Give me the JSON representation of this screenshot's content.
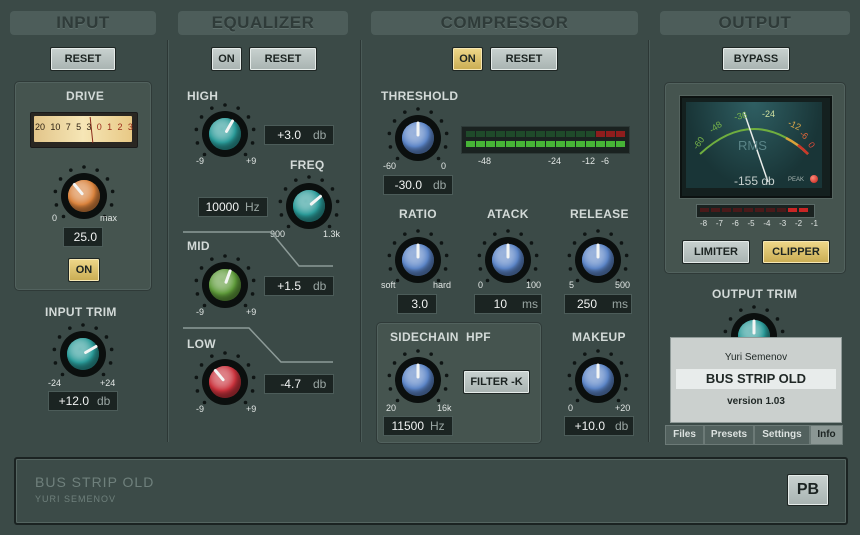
{
  "sections": {
    "input": "INPUT",
    "equalizer": "EQUALIZER",
    "compressor": "COMPRESSOR",
    "output": "OUTPUT"
  },
  "buttons": {
    "input_reset": "RESET",
    "eq_on": "ON",
    "eq_reset": "RESET",
    "comp_on": "ON",
    "comp_reset": "RESET",
    "bypass": "BYPASS",
    "drive_on": "ON",
    "filter_k": "FILTER -K",
    "limiter": "LIMITER",
    "clipper": "CLIPPER",
    "pb": "PB"
  },
  "input": {
    "drive": {
      "label": "DRIVE",
      "min": "0",
      "max": "max",
      "value": "25.0"
    },
    "vu_scale": [
      "20",
      "10",
      "7",
      "5",
      "3",
      "0",
      "1",
      "2",
      "3"
    ],
    "trim": {
      "label": "INPUT TRIM",
      "min": "-24",
      "max": "+24",
      "value": "+12.0",
      "unit": "db"
    }
  },
  "eq": {
    "high": {
      "label": "HIGH",
      "min": "-9",
      "max": "+9",
      "value": "+3.0",
      "unit": "db"
    },
    "freq": {
      "label": "FREQ",
      "min": "900",
      "max": "1.3k",
      "value": "10000",
      "unit": "Hz"
    },
    "mid": {
      "label": "MID",
      "min": "-9",
      "max": "+9",
      "value": "+1.5",
      "unit": "db"
    },
    "low": {
      "label": "LOW",
      "min": "-9",
      "max": "+9",
      "value": "-4.7",
      "unit": "db"
    }
  },
  "comp": {
    "threshold": {
      "label": "THRESHOLD",
      "min": "-60",
      "max": "0",
      "value": "-30.0",
      "unit": "db"
    },
    "meter_scale": [
      "-48",
      "-24",
      "-12",
      "-6"
    ],
    "ratio": {
      "label": "RATIO",
      "min": "soft",
      "max": "hard",
      "value": "3.0"
    },
    "attack": {
      "label": "ATACK",
      "min": "0",
      "max": "100",
      "value": "10",
      "unit": "ms"
    },
    "release": {
      "label": "RELEASE",
      "min": "5",
      "max": "500",
      "value": "250",
      "unit": "ms"
    },
    "sidechain": {
      "label": "SIDECHAIN  HPF",
      "min": "20",
      "max": "16k",
      "value": "11500",
      "unit": "Hz"
    },
    "makeup": {
      "label": "MAKEUP",
      "min": "0",
      "max": "+20",
      "value": "+10.0",
      "unit": "db"
    }
  },
  "output": {
    "vu": {
      "arc": [
        "-60",
        "-48",
        "-36",
        "-24",
        "-12",
        "-6",
        "0"
      ],
      "rms": "RMS",
      "readout": "-155 db",
      "peak": "PEAK"
    },
    "mini_scale": [
      "-8",
      "-7",
      "-6",
      "-5",
      "-4",
      "-3",
      "-2",
      "-1"
    ],
    "trim": {
      "label": "OUTPUT TRIM"
    }
  },
  "info": {
    "author": "Yuri Semenov",
    "product": "BUS STRIP OLD",
    "version": "version 1.03",
    "tabs": [
      "Files",
      "Presets",
      "Settings",
      "Info"
    ]
  },
  "footer": {
    "title": "BUS STRIP OLD",
    "subtitle": "YURI SEMENOV"
  },
  "colors": {
    "knob_teal": "#2a9a98",
    "knob_orange": "#d9823c",
    "knob_green": "#5e9a3a",
    "knob_red": "#c9323c",
    "knob_blue": "#5b84c6",
    "button_active": "#e3c773"
  }
}
